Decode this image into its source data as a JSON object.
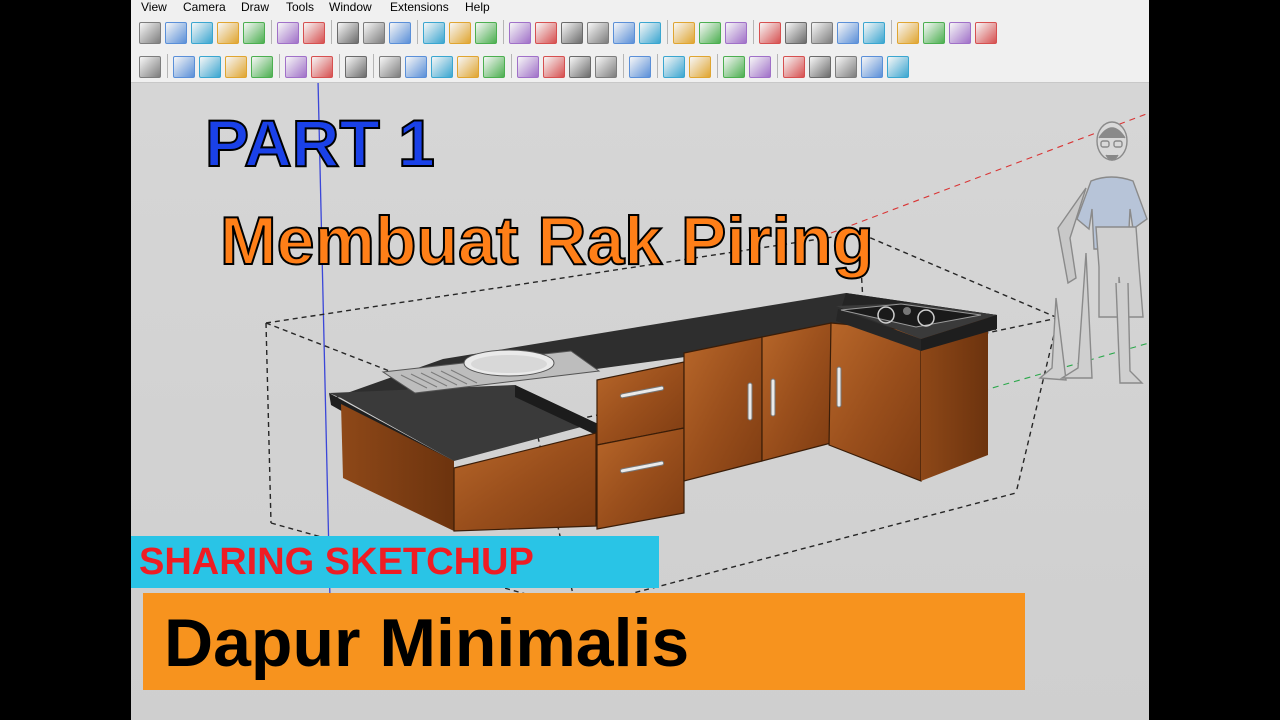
{
  "menu": {
    "items": [
      "View",
      "Camera",
      "Draw",
      "Tools",
      "Window",
      "Extensions",
      "Help"
    ]
  },
  "overlay": {
    "part": "PART 1",
    "title": "Membuat Rak Piring",
    "channel": "SHARING SKETCHUP",
    "subtitle": "Dapur Minimalis"
  },
  "colors": {
    "part_text": "#1a41e8",
    "title_text": "#ff7f18",
    "channel_band": "#29c4e6",
    "channel_text": "#ee1d24",
    "subtitle_band": "#f7931e",
    "countertop": "#3a3a3a",
    "cabinet_wood": "#a0551f",
    "viewport_bg": "#d4d4d4"
  },
  "toolbar": {
    "row1_icons": [
      "style-xray-icon",
      "style-backedges-icon",
      "style-wireframe-icon",
      "style-hiddenline-icon",
      "style-shaded-icon",
      "select-tool-icon",
      "check-circle-icon",
      "teapot-icon",
      "scene-save-icon",
      "photo-match-icon",
      "window-icon",
      "camera-view-icon",
      "lock-icon",
      "iso-view-icon",
      "top-view-icon",
      "front-view-icon",
      "right-view-icon",
      "back-view-icon",
      "left-view-icon",
      "section-plane-icon",
      "section-fill-icon",
      "dimension-icon",
      "angle-icon",
      "protractor-icon",
      "axes-icon",
      "sun-icon",
      "shadow-icon",
      "component-icon",
      "style-icon",
      "material-icon",
      "grass-icon"
    ],
    "row2_icons": [
      "print-icon",
      "layer-icon",
      "layer2-icon",
      "layer3-icon",
      "layer4-icon",
      "outliner-icon",
      "outliner2-icon",
      "globe-icon",
      "shield-icon",
      "refresh-icon",
      "component-browser-icon",
      "flashlight-icon",
      "camera-icon",
      "goggles-icon",
      "add-icon",
      "tree-icon",
      "settings-icon",
      "sound-icon",
      "sliders-icon",
      "sliders2-icon",
      "message-icon",
      "info-icon",
      "push-pull-icon",
      "move-up-icon",
      "rotate-icon",
      "scale-icon",
      "dynamic-icon"
    ]
  }
}
